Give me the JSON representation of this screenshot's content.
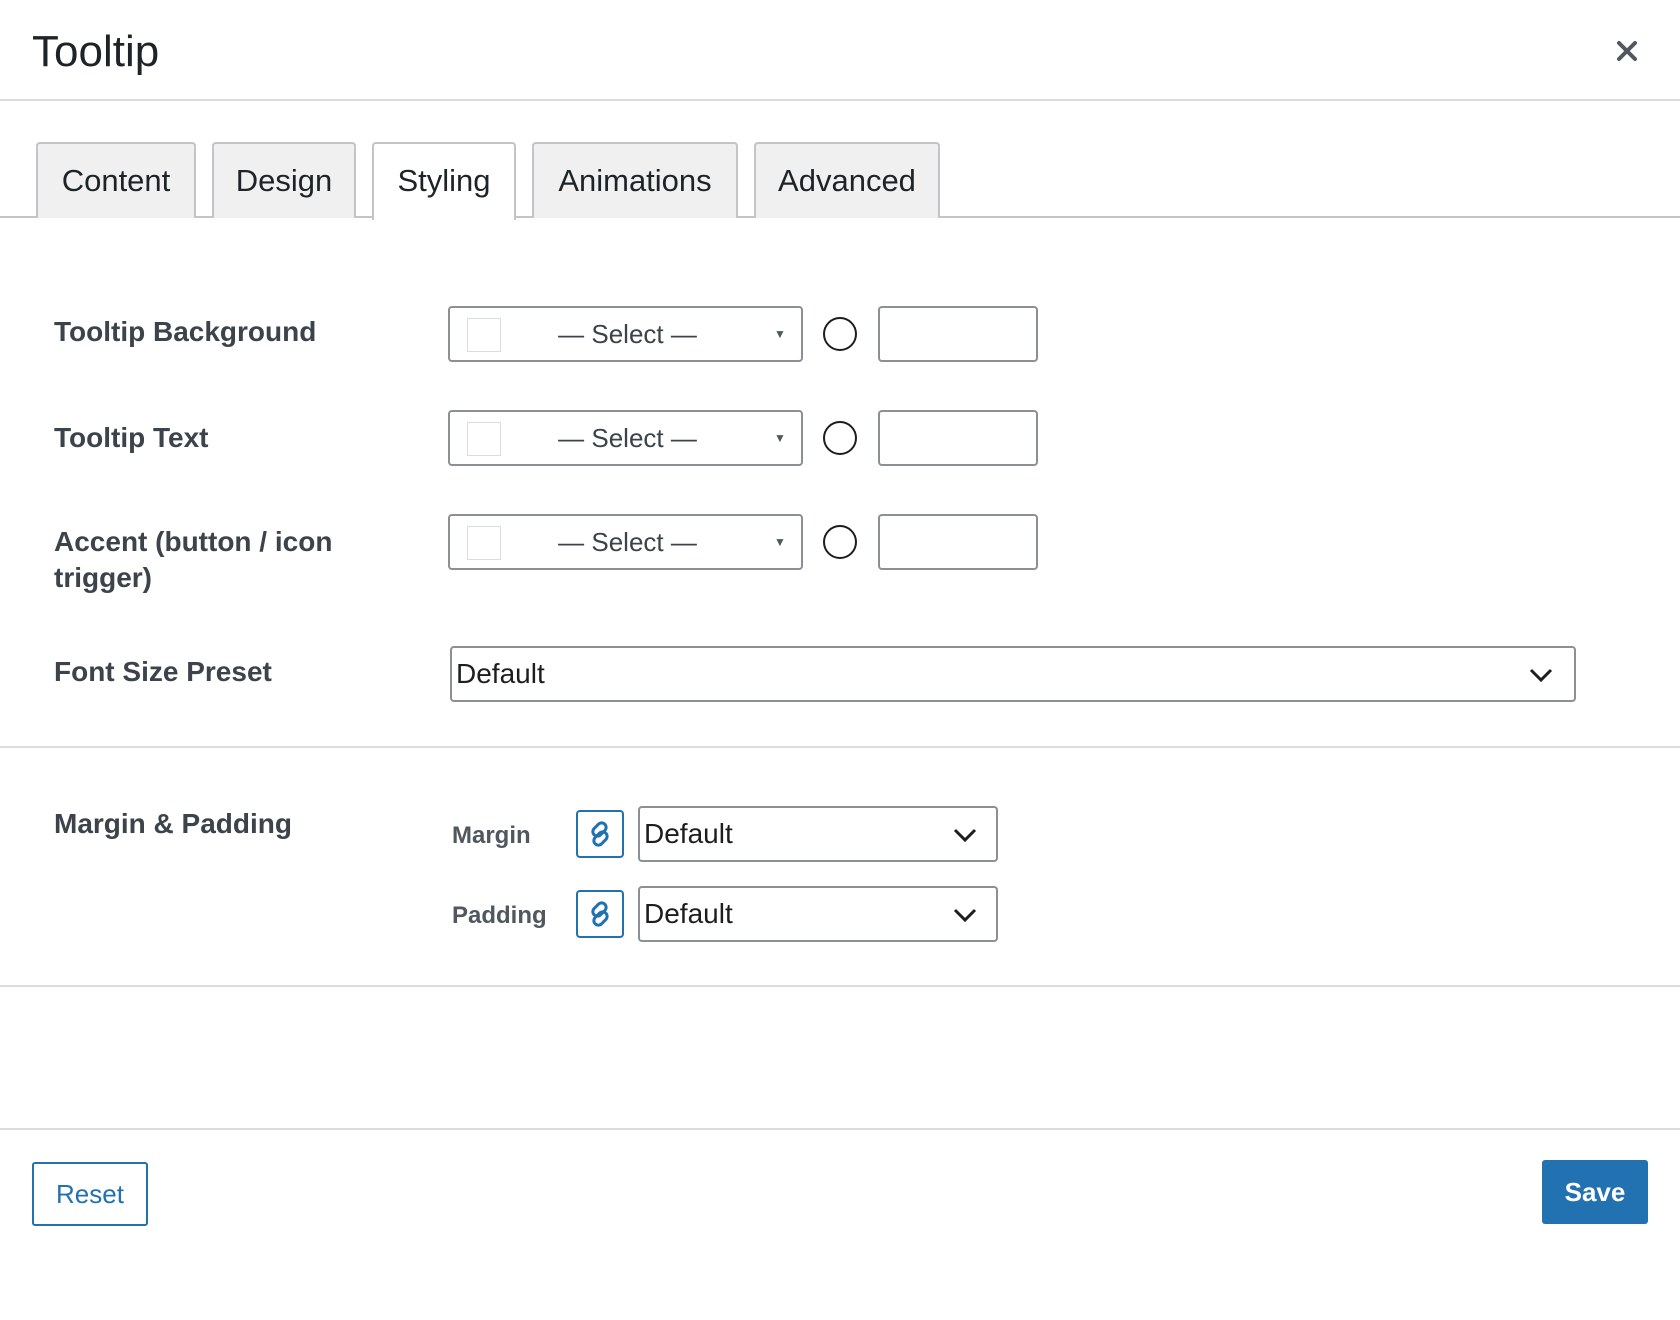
{
  "modal": {
    "title": "Tooltip",
    "close_icon": "close-icon"
  },
  "tabs": [
    {
      "label": "Content",
      "active": false
    },
    {
      "label": "Design",
      "active": false
    },
    {
      "label": "Styling",
      "active": true
    },
    {
      "label": "Animations",
      "active": false
    },
    {
      "label": "Advanced",
      "active": false
    }
  ],
  "styling": {
    "tooltip_background": {
      "label": "Tooltip Background",
      "select": "— Select —",
      "hex": ""
    },
    "tooltip_text": {
      "label": "Tooltip Text",
      "select": "— Select —",
      "hex": ""
    },
    "accent": {
      "label_line1": "Accent (button / icon",
      "label_line2": "trigger)",
      "select": "— Select —",
      "hex": ""
    },
    "font_size_preset": {
      "label": "Font Size Preset",
      "value": "Default"
    }
  },
  "spacing": {
    "label": "Margin & Padding",
    "margin": {
      "label": "Margin",
      "value": "Default"
    },
    "padding": {
      "label": "Padding",
      "value": "Default"
    }
  },
  "footer": {
    "reset_label": "Reset",
    "save_label": "Save"
  },
  "colors": {
    "accent": "#2271b1",
    "border": "#8c8f94"
  }
}
